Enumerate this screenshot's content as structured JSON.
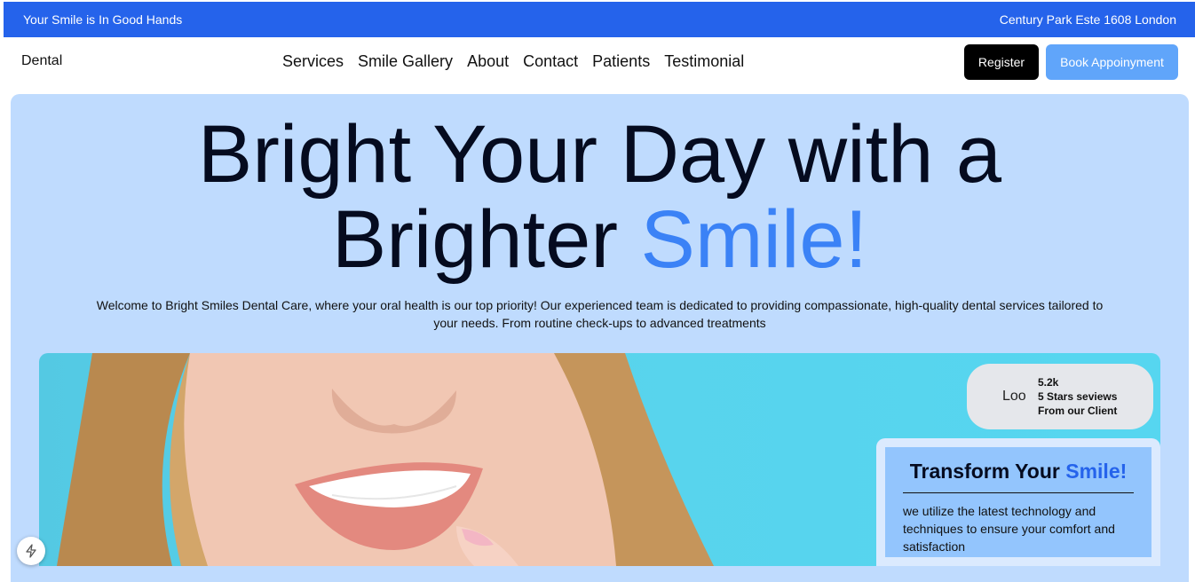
{
  "topbar": {
    "tagline": "Your Smile is In Good Hands",
    "address": "Century Park Este 1608 London"
  },
  "nav": {
    "brand": "Dental",
    "links": [
      "Services",
      "Smile Gallery",
      "About",
      "Contact",
      "Patients",
      "Testimonial"
    ],
    "register_label": "Register",
    "book_label": "Book Appoinyment"
  },
  "hero": {
    "headline_line1": "Bright Your Day with a",
    "headline_line2_main": "Brighter",
    "headline_line2_accent": "Smile!",
    "intro": "Welcome to Bright Smiles Dental Care, where your oral health is our top priority! Our experienced team is dedicated to providing compassionate, high-quality dental services tailored to your needs. From routine check-ups to advanced treatments"
  },
  "stats": {
    "logo_text": "Loo",
    "count": "5.2k",
    "line2": "5 Stars seviews",
    "line3": "From our Client"
  },
  "card": {
    "title_main": "Transform Your",
    "title_accent": "Smile!",
    "text": "we utilize the latest technology and techniques to ensure your comfort and satisfaction"
  },
  "colors": {
    "topbar": "#2563eb",
    "hero_bg": "#bfdbfe",
    "accent": "#3b82f6",
    "book_button": "#60a5fa",
    "card_bg": "#93c5fd"
  },
  "icons": {
    "widget": "bolt-icon"
  }
}
